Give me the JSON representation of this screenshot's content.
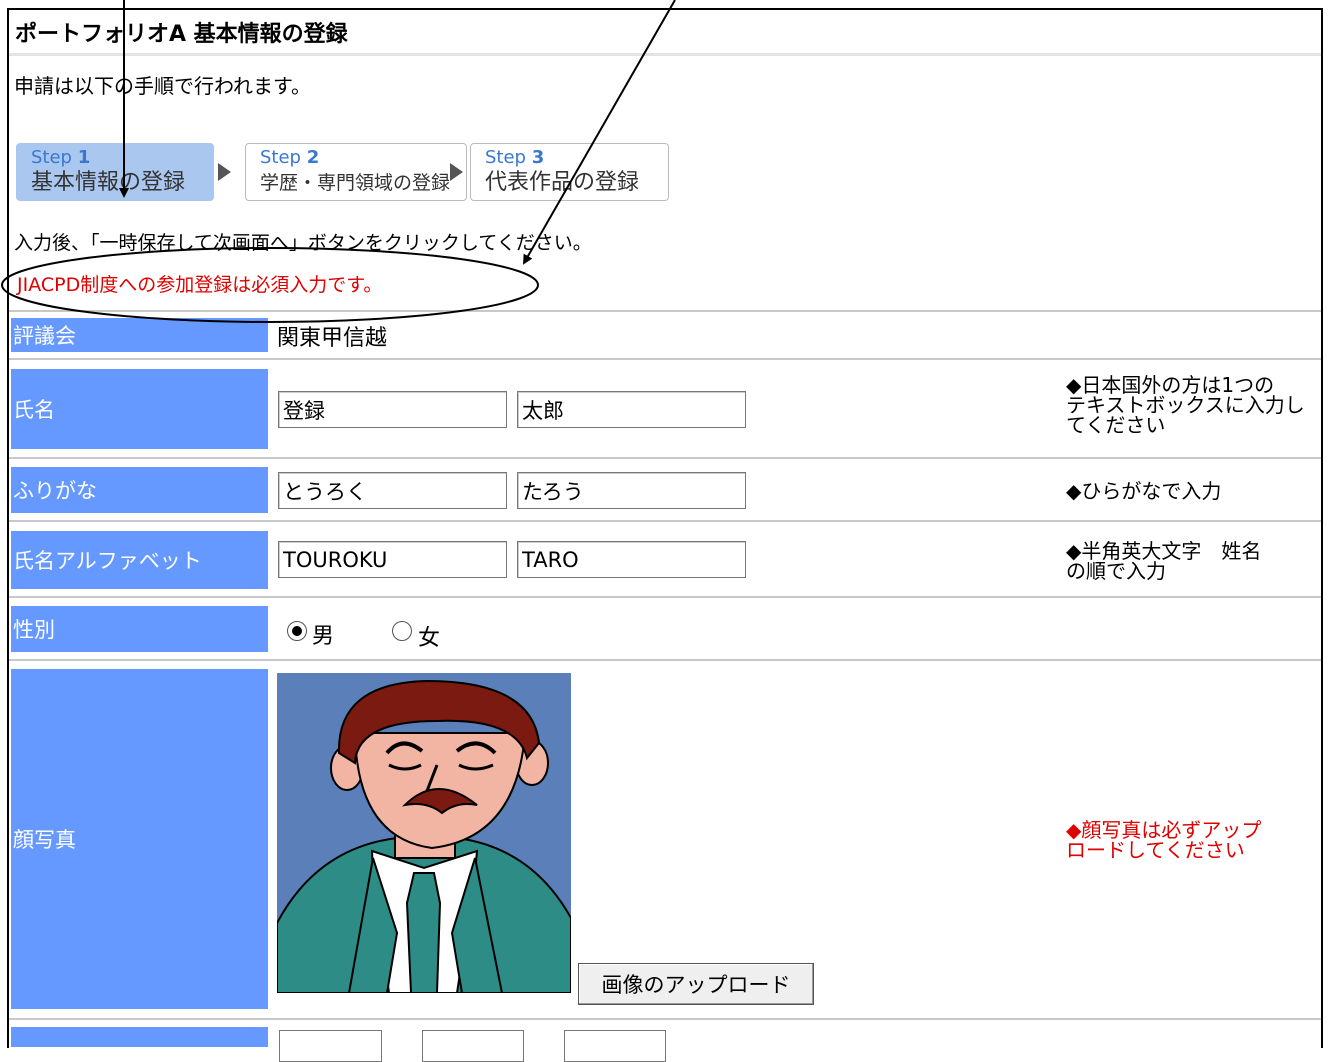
{
  "title": "ポートフォリオA  基本情報の登録",
  "intro": "申請は以下の手順で行われます。",
  "steps": [
    {
      "num_prefix": "Step ",
      "num": "1",
      "label": "基本情報の登録"
    },
    {
      "num_prefix": "Step ",
      "num": "2",
      "label": "学歴・専門領域の登録"
    },
    {
      "num_prefix": "Step ",
      "num": "3",
      "label": "代表作品の登録"
    }
  ],
  "instruction": "入力後、「一時保存して次画面へ」ボタンをクリックしてください。",
  "required_note": "JIACPD制度への参加登録は必須入力です。",
  "form": {
    "council": {
      "label": "評議会",
      "value": "関東甲信越"
    },
    "name": {
      "label": "氏名",
      "last": "登録",
      "first": "太郎",
      "note": "◆日本国外の方は1つの\nテキストボックスに入力し\nてください"
    },
    "furigana": {
      "label": "ふりがな",
      "last": "とうろく",
      "first": "たろう",
      "note": "◆ひらがなで入力"
    },
    "alphabet": {
      "label": "氏名アルファベット",
      "last": "TOUROKU",
      "first": "TARO",
      "note": "◆半角英大文字　姓名\nの順で入力"
    },
    "gender": {
      "label": "性別",
      "options": [
        "男",
        "女"
      ],
      "selected": "男"
    },
    "photo": {
      "label": "顔写真",
      "upload_button": "画像のアップロード",
      "note": "◆顔写真は必ずアップ\nロードしてください"
    }
  },
  "colors": {
    "label_bg": "#6699ff",
    "required": "#e00000",
    "step_active": "#a9c7ef"
  }
}
